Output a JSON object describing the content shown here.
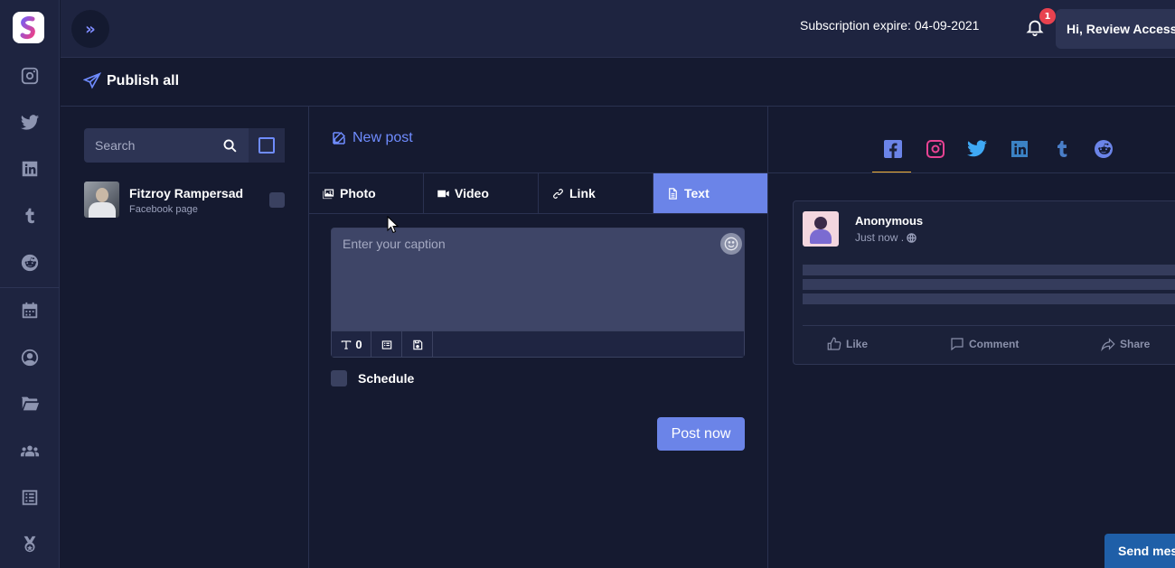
{
  "header": {
    "subscription": "Subscription expire: 04-09-2021",
    "notification_count": "1",
    "greeting": "Hi, Review Access"
  },
  "sidebar": {
    "items": [
      {
        "icon": "instagram-icon"
      },
      {
        "icon": "twitter-icon"
      },
      {
        "icon": "linkedin-icon"
      },
      {
        "icon": "tumblr-icon"
      },
      {
        "icon": "reddit-icon"
      },
      {
        "icon": "calendar-icon"
      },
      {
        "icon": "user-circle-icon"
      },
      {
        "icon": "folder-icon"
      },
      {
        "icon": "users-icon"
      },
      {
        "icon": "list-icon"
      },
      {
        "icon": "medal-icon"
      }
    ]
  },
  "page": {
    "title": "Publish all"
  },
  "accounts": {
    "search_placeholder": "Search",
    "items": [
      {
        "name": "Fitzroy Rampersad",
        "type": "Facebook page"
      }
    ]
  },
  "composer": {
    "new_post_label": "New post",
    "tabs": [
      {
        "label": "Photo",
        "active": false
      },
      {
        "label": "Video",
        "active": false
      },
      {
        "label": "Link",
        "active": false
      },
      {
        "label": "Text",
        "active": true
      }
    ],
    "caption_placeholder": "Enter your caption",
    "caption_value": "",
    "char_count": "0",
    "schedule_label": "Schedule",
    "post_now_label": "Post now"
  },
  "preview": {
    "platforms": [
      "facebook",
      "instagram",
      "twitter",
      "linkedin",
      "tumblr",
      "reddit"
    ],
    "active_platform": "facebook",
    "author": "Anonymous",
    "time": "Just now .",
    "actions": {
      "like": "Like",
      "comment": "Comment",
      "share": "Share"
    }
  },
  "chat": {
    "send_label": "Send message"
  },
  "colors": {
    "accent": "#6b84e8",
    "background": "#151a30",
    "panel": "#1e2440",
    "badge": "#e8424f",
    "tab_underline": "#f2b134"
  }
}
